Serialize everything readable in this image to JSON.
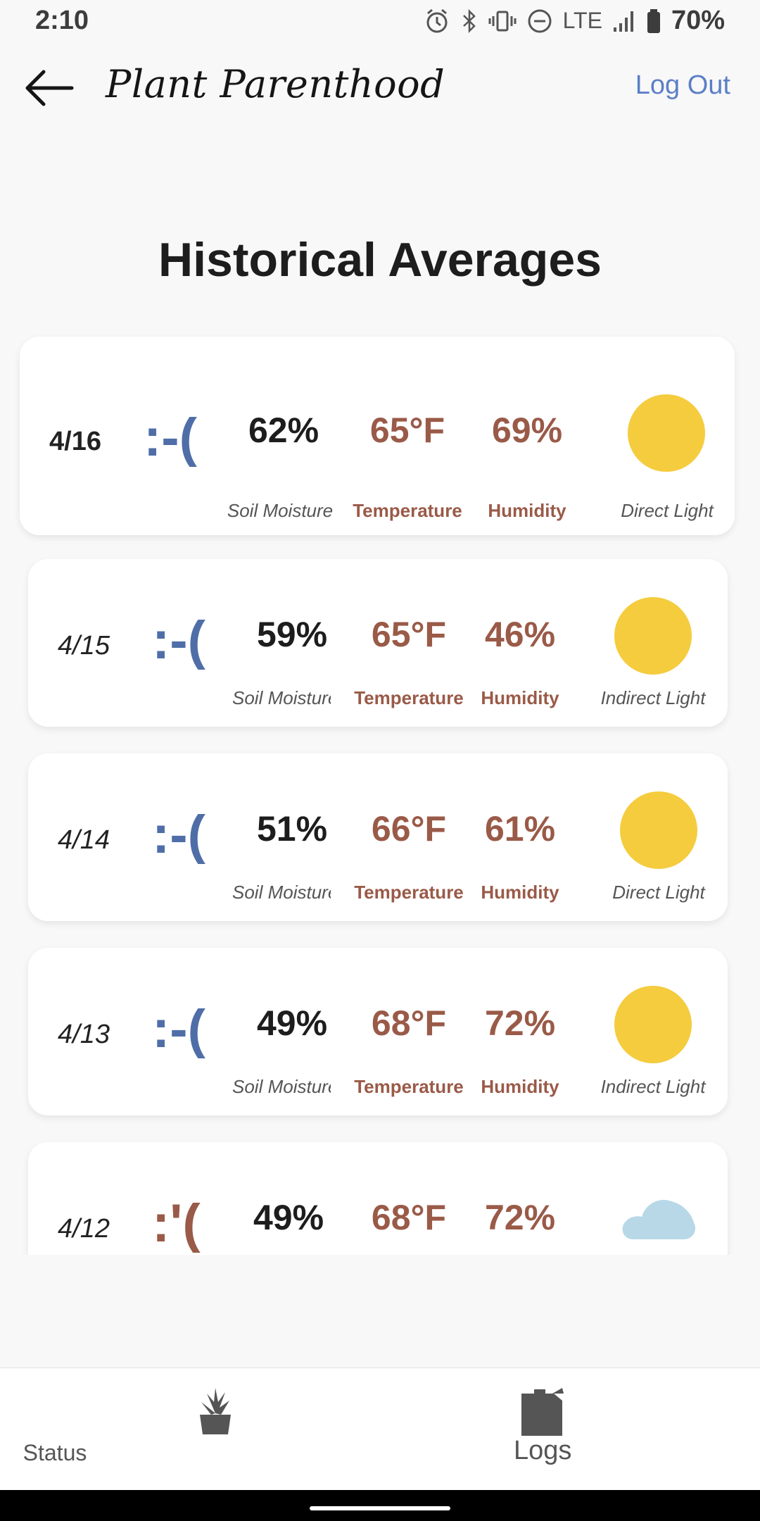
{
  "status_bar": {
    "time": "2:10",
    "network": "LTE",
    "battery": "70%"
  },
  "app_bar": {
    "title": "Plant Parenthood",
    "logout": "Log Out"
  },
  "page": {
    "title": "Historical Averages"
  },
  "colors": {
    "sun": "#f5cc3e",
    "cloud": "#b8d8e8",
    "sad_blue": "#4f6ea8",
    "crying_brown": "#9a5a48",
    "metric_brown": "#9a5a48"
  },
  "entries": [
    {
      "date": "4/16",
      "mood": ":-(",
      "moisture": "62%",
      "moisture_label": "Soil Moisture",
      "temperature": "65°F",
      "temperature_label": "Temperature",
      "humidity": "69%",
      "humidity_label": "Humidity",
      "light_icon": "sun-icon",
      "light_label": "Direct Light"
    },
    {
      "date": "4/15",
      "mood": ":-(",
      "moisture": "59%",
      "moisture_label": "Soil Moisture",
      "temperature": "65°F",
      "temperature_label": "Temperature",
      "humidity": "46%",
      "humidity_label": "Humidity",
      "light_icon": "sun-icon",
      "light_label": "Indirect Light"
    },
    {
      "date": "4/14",
      "mood": ":-(",
      "moisture": "51%",
      "moisture_label": "Soil Moisture",
      "temperature": "66°F",
      "temperature_label": "Temperature",
      "humidity": "61%",
      "humidity_label": "Humidity",
      "light_icon": "sun-icon",
      "light_label": "Direct Light"
    },
    {
      "date": "4/13",
      "mood": ":-(",
      "moisture": "49%",
      "moisture_label": "Soil Moisture",
      "temperature": "68°F",
      "temperature_label": "Temperature",
      "humidity": "72%",
      "humidity_label": "Humidity",
      "light_icon": "sun-icon",
      "light_label": "Indirect Light"
    },
    {
      "date": "4/12",
      "mood": ":'(",
      "moisture": "49%",
      "temperature": "68°F",
      "humidity": "72%",
      "light_icon": "cloud-icon"
    }
  ],
  "bottom_nav": {
    "status_label": "Status",
    "logs_label": "Logs"
  }
}
